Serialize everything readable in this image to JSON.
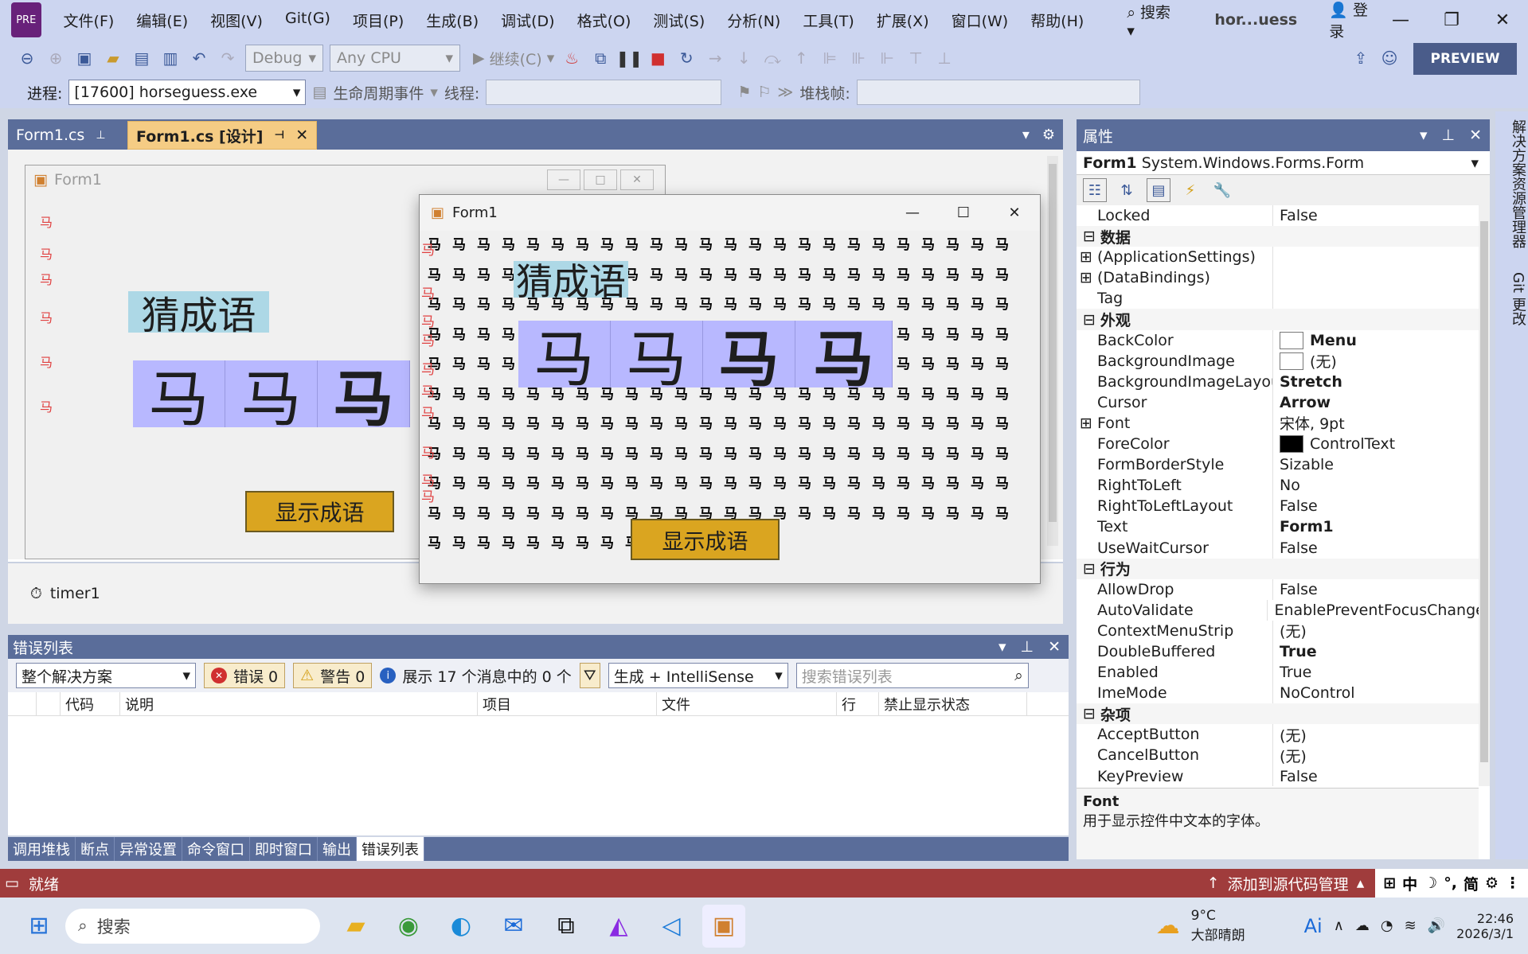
{
  "menubar": {
    "items": [
      "文件(F)",
      "编辑(E)",
      "视图(V)",
      "Git(G)",
      "项目(P)",
      "生成(B)",
      "调试(D)",
      "格式(O)",
      "测试(S)",
      "分析(N)",
      "工具(T)",
      "扩展(X)",
      "窗口(W)",
      "帮助(H)"
    ],
    "search": "搜索",
    "solution": "hor...uess",
    "login": "登录"
  },
  "toolbar": {
    "config": "Debug",
    "platform": "Any CPU",
    "continue": "继续(C)",
    "preview": "PREVIEW"
  },
  "procbar": {
    "process_label": "进程:",
    "process_value": "[17600] horseguess.exe",
    "lifecycle": "生命周期事件",
    "thread_label": "线程:",
    "stackframe_label": "堆栈帧:"
  },
  "doc_tabs": [
    {
      "label": "Form1.cs"
    },
    {
      "label": "Form1.cs [设计]"
    }
  ],
  "designer": {
    "form_title": "Form1",
    "label_text": "猜成语",
    "cells": [
      "马",
      "马",
      "马"
    ],
    "button_text": "显示成语",
    "timer": "timer1"
  },
  "runform": {
    "title": "Form1",
    "label_text": "猜成语",
    "cells": [
      "马",
      "马",
      "马",
      "马"
    ],
    "button_text": "显示成语",
    "bg_char": "马"
  },
  "properties": {
    "title": "属性",
    "object": "Form1",
    "object_type": "System.Windows.Forms.Form",
    "rows": [
      {
        "kind": "prop",
        "name": "Locked",
        "value": "False"
      },
      {
        "kind": "cat",
        "name": "数据"
      },
      {
        "kind": "prop",
        "name": "(ApplicationSettings)",
        "value": "",
        "expand": true
      },
      {
        "kind": "prop",
        "name": "(DataBindings)",
        "value": "",
        "expand": true
      },
      {
        "kind": "prop",
        "name": "Tag",
        "value": ""
      },
      {
        "kind": "cat",
        "name": "外观"
      },
      {
        "kind": "prop",
        "name": "BackColor",
        "value": "Menu",
        "swatch": "#ffffff",
        "bold": true
      },
      {
        "kind": "prop",
        "name": "BackgroundImage",
        "value": "(无)",
        "swatch": "#ffffff"
      },
      {
        "kind": "prop",
        "name": "BackgroundImageLayout",
        "value": "Stretch",
        "bold": true
      },
      {
        "kind": "prop",
        "name": "Cursor",
        "value": "Arrow",
        "bold": true
      },
      {
        "kind": "prop",
        "name": "Font",
        "value": "宋体, 9pt",
        "expand": true
      },
      {
        "kind": "prop",
        "name": "ForeColor",
        "value": "ControlText",
        "swatch": "#000000"
      },
      {
        "kind": "prop",
        "name": "FormBorderStyle",
        "value": "Sizable"
      },
      {
        "kind": "prop",
        "name": "RightToLeft",
        "value": "No"
      },
      {
        "kind": "prop",
        "name": "RightToLeftLayout",
        "value": "False"
      },
      {
        "kind": "prop",
        "name": "Text",
        "value": "Form1",
        "bold": true
      },
      {
        "kind": "prop",
        "name": "UseWaitCursor",
        "value": "False"
      },
      {
        "kind": "cat",
        "name": "行为"
      },
      {
        "kind": "prop",
        "name": "AllowDrop",
        "value": "False"
      },
      {
        "kind": "prop",
        "name": "AutoValidate",
        "value": "EnablePreventFocusChange"
      },
      {
        "kind": "prop",
        "name": "ContextMenuStrip",
        "value": "(无)"
      },
      {
        "kind": "prop",
        "name": "DoubleBuffered",
        "value": "True",
        "bold": true
      },
      {
        "kind": "prop",
        "name": "Enabled",
        "value": "True"
      },
      {
        "kind": "prop",
        "name": "ImeMode",
        "value": "NoControl"
      },
      {
        "kind": "cat",
        "name": "杂项"
      },
      {
        "kind": "prop",
        "name": "AcceptButton",
        "value": "(无)"
      },
      {
        "kind": "prop",
        "name": "CancelButton",
        "value": "(无)"
      },
      {
        "kind": "prop",
        "name": "KeyPreview",
        "value": "False"
      }
    ],
    "desc_title": "Font",
    "desc_text": "用于显示控件中文本的字体。"
  },
  "sidestrip": [
    "解决方案资源管理器",
    "Git 更改"
  ],
  "errorlist": {
    "title": "错误列表",
    "scope": "整个解决方案",
    "errors": "错误 0",
    "warnings": "警告 0",
    "messages": "展示 17 个消息中的 0 个",
    "build": "生成 + IntelliSense",
    "search_placeholder": "搜索错误列表",
    "columns": [
      "代码",
      "说明",
      "项目",
      "文件",
      "行",
      "禁止显示状态"
    ]
  },
  "bottom_tabs": [
    "调用堆栈",
    "断点",
    "异常设置",
    "命令窗口",
    "即时窗口",
    "输出",
    "错误列表"
  ],
  "status": {
    "ready": "就绪",
    "source_control": "添加到源代码管理"
  },
  "taskbar": {
    "search": "搜索",
    "weather_temp": "9°C",
    "weather_desc": "大部晴朗",
    "time": "22:46",
    "date": "2026/3/1",
    "ime": "中"
  },
  "colors": {
    "accent": "#68217a",
    "status_bar": "#a03c3c",
    "label_bg": "#add8e6",
    "cell_bg": "#b8b8ff",
    "button_bg": "#daa520"
  }
}
